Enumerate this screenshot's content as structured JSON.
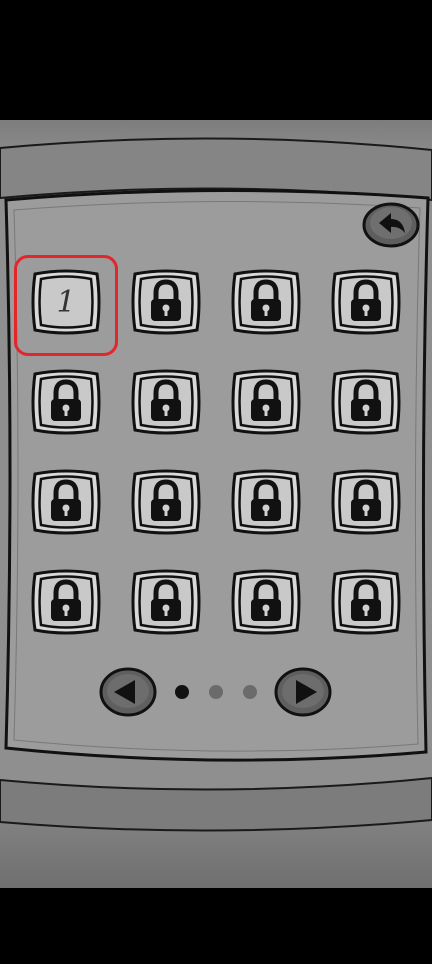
{
  "level_select": {
    "levels": [
      {
        "number": "1",
        "locked": false,
        "selected": true
      },
      {
        "number": "",
        "locked": true
      },
      {
        "number": "",
        "locked": true
      },
      {
        "number": "",
        "locked": true
      },
      {
        "number": "",
        "locked": true
      },
      {
        "number": "",
        "locked": true
      },
      {
        "number": "",
        "locked": true
      },
      {
        "number": "",
        "locked": true
      },
      {
        "number": "",
        "locked": true
      },
      {
        "number": "",
        "locked": true
      },
      {
        "number": "",
        "locked": true
      },
      {
        "number": "",
        "locked": true
      },
      {
        "number": "",
        "locked": true
      },
      {
        "number": "",
        "locked": true
      },
      {
        "number": "",
        "locked": true
      },
      {
        "number": "",
        "locked": true
      }
    ],
    "pagination": {
      "current_page": 1,
      "total_pages": 3
    },
    "colors": {
      "selection": "#e3262b",
      "tile_fill": "#c9c9c9",
      "board": "#9c9c9c",
      "outline": "#111111"
    },
    "icons": {
      "back": "back-arrow-icon",
      "locked": "padlock-icon",
      "prev": "left-triangle-icon",
      "next": "right-triangle-icon"
    }
  }
}
